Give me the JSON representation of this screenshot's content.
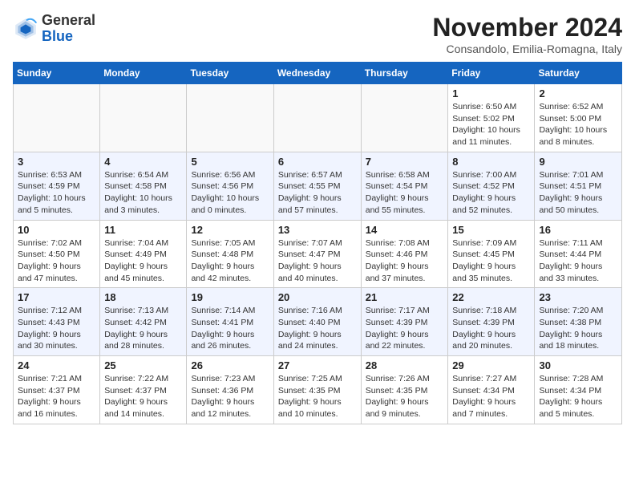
{
  "logo": {
    "general": "General",
    "blue": "Blue"
  },
  "title": "November 2024",
  "location": "Consandolo, Emilia-Romagna, Italy",
  "days_of_week": [
    "Sunday",
    "Monday",
    "Tuesday",
    "Wednesday",
    "Thursday",
    "Friday",
    "Saturday"
  ],
  "weeks": [
    [
      {
        "day": "",
        "info": ""
      },
      {
        "day": "",
        "info": ""
      },
      {
        "day": "",
        "info": ""
      },
      {
        "day": "",
        "info": ""
      },
      {
        "day": "",
        "info": ""
      },
      {
        "day": "1",
        "info": "Sunrise: 6:50 AM\nSunset: 5:02 PM\nDaylight: 10 hours and 11 minutes."
      },
      {
        "day": "2",
        "info": "Sunrise: 6:52 AM\nSunset: 5:00 PM\nDaylight: 10 hours and 8 minutes."
      }
    ],
    [
      {
        "day": "3",
        "info": "Sunrise: 6:53 AM\nSunset: 4:59 PM\nDaylight: 10 hours and 5 minutes."
      },
      {
        "day": "4",
        "info": "Sunrise: 6:54 AM\nSunset: 4:58 PM\nDaylight: 10 hours and 3 minutes."
      },
      {
        "day": "5",
        "info": "Sunrise: 6:56 AM\nSunset: 4:56 PM\nDaylight: 10 hours and 0 minutes."
      },
      {
        "day": "6",
        "info": "Sunrise: 6:57 AM\nSunset: 4:55 PM\nDaylight: 9 hours and 57 minutes."
      },
      {
        "day": "7",
        "info": "Sunrise: 6:58 AM\nSunset: 4:54 PM\nDaylight: 9 hours and 55 minutes."
      },
      {
        "day": "8",
        "info": "Sunrise: 7:00 AM\nSunset: 4:52 PM\nDaylight: 9 hours and 52 minutes."
      },
      {
        "day": "9",
        "info": "Sunrise: 7:01 AM\nSunset: 4:51 PM\nDaylight: 9 hours and 50 minutes."
      }
    ],
    [
      {
        "day": "10",
        "info": "Sunrise: 7:02 AM\nSunset: 4:50 PM\nDaylight: 9 hours and 47 minutes."
      },
      {
        "day": "11",
        "info": "Sunrise: 7:04 AM\nSunset: 4:49 PM\nDaylight: 9 hours and 45 minutes."
      },
      {
        "day": "12",
        "info": "Sunrise: 7:05 AM\nSunset: 4:48 PM\nDaylight: 9 hours and 42 minutes."
      },
      {
        "day": "13",
        "info": "Sunrise: 7:07 AM\nSunset: 4:47 PM\nDaylight: 9 hours and 40 minutes."
      },
      {
        "day": "14",
        "info": "Sunrise: 7:08 AM\nSunset: 4:46 PM\nDaylight: 9 hours and 37 minutes."
      },
      {
        "day": "15",
        "info": "Sunrise: 7:09 AM\nSunset: 4:45 PM\nDaylight: 9 hours and 35 minutes."
      },
      {
        "day": "16",
        "info": "Sunrise: 7:11 AM\nSunset: 4:44 PM\nDaylight: 9 hours and 33 minutes."
      }
    ],
    [
      {
        "day": "17",
        "info": "Sunrise: 7:12 AM\nSunset: 4:43 PM\nDaylight: 9 hours and 30 minutes."
      },
      {
        "day": "18",
        "info": "Sunrise: 7:13 AM\nSunset: 4:42 PM\nDaylight: 9 hours and 28 minutes."
      },
      {
        "day": "19",
        "info": "Sunrise: 7:14 AM\nSunset: 4:41 PM\nDaylight: 9 hours and 26 minutes."
      },
      {
        "day": "20",
        "info": "Sunrise: 7:16 AM\nSunset: 4:40 PM\nDaylight: 9 hours and 24 minutes."
      },
      {
        "day": "21",
        "info": "Sunrise: 7:17 AM\nSunset: 4:39 PM\nDaylight: 9 hours and 22 minutes."
      },
      {
        "day": "22",
        "info": "Sunrise: 7:18 AM\nSunset: 4:39 PM\nDaylight: 9 hours and 20 minutes."
      },
      {
        "day": "23",
        "info": "Sunrise: 7:20 AM\nSunset: 4:38 PM\nDaylight: 9 hours and 18 minutes."
      }
    ],
    [
      {
        "day": "24",
        "info": "Sunrise: 7:21 AM\nSunset: 4:37 PM\nDaylight: 9 hours and 16 minutes."
      },
      {
        "day": "25",
        "info": "Sunrise: 7:22 AM\nSunset: 4:37 PM\nDaylight: 9 hours and 14 minutes."
      },
      {
        "day": "26",
        "info": "Sunrise: 7:23 AM\nSunset: 4:36 PM\nDaylight: 9 hours and 12 minutes."
      },
      {
        "day": "27",
        "info": "Sunrise: 7:25 AM\nSunset: 4:35 PM\nDaylight: 9 hours and 10 minutes."
      },
      {
        "day": "28",
        "info": "Sunrise: 7:26 AM\nSunset: 4:35 PM\nDaylight: 9 hours and 9 minutes."
      },
      {
        "day": "29",
        "info": "Sunrise: 7:27 AM\nSunset: 4:34 PM\nDaylight: 9 hours and 7 minutes."
      },
      {
        "day": "30",
        "info": "Sunrise: 7:28 AM\nSunset: 4:34 PM\nDaylight: 9 hours and 5 minutes."
      }
    ]
  ]
}
